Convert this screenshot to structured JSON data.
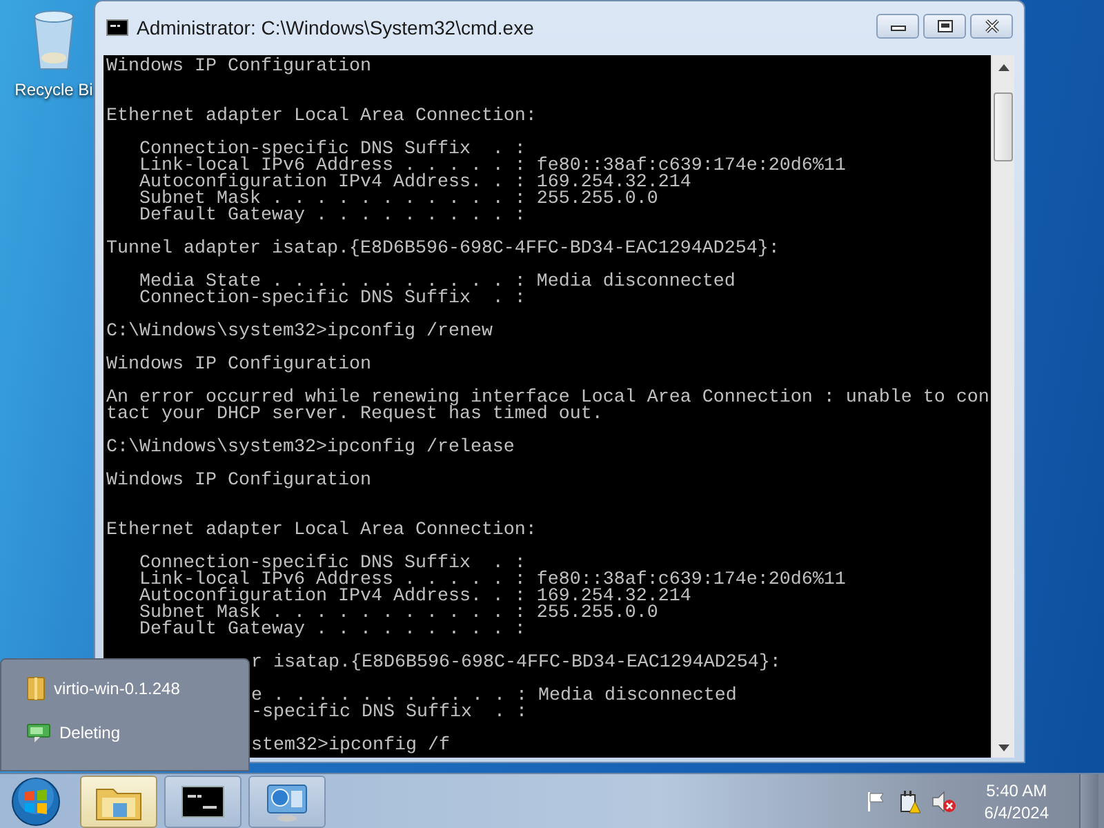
{
  "desktop": {
    "icons": [
      {
        "label": "Recycle Bi",
        "kind": "recycle-bin"
      }
    ]
  },
  "window": {
    "title": "Administrator: C:\\Windows\\System32\\cmd.exe",
    "console_lines": [
      {
        "kind": "line",
        "text": "Windows IP Configuration"
      },
      {
        "kind": "blank"
      },
      {
        "kind": "blank"
      },
      {
        "kind": "line",
        "text": "Ethernet adapter Local Area Connection:"
      },
      {
        "kind": "blank"
      },
      {
        "kind": "line",
        "text": "   Connection-specific DNS Suffix  . :"
      },
      {
        "kind": "line",
        "text": "   Link-local IPv6 Address . . . . . : fe80::38af:c639:174e:20d6%11"
      },
      {
        "kind": "line",
        "text": "   Autoconfiguration IPv4 Address. . : 169.254.32.214"
      },
      {
        "kind": "line",
        "text": "   Subnet Mask . . . . . . . . . . . : 255.255.0.0"
      },
      {
        "kind": "line",
        "text": "   Default Gateway . . . . . . . . . :"
      },
      {
        "kind": "blank"
      },
      {
        "kind": "line",
        "text": "Tunnel adapter isatap.{E8D6B596-698C-4FFC-BD34-EAC1294AD254}:"
      },
      {
        "kind": "blank"
      },
      {
        "kind": "line",
        "text": "   Media State . . . . . . . . . . . : Media disconnected"
      },
      {
        "kind": "line",
        "text": "   Connection-specific DNS Suffix  . :"
      },
      {
        "kind": "blank"
      },
      {
        "kind": "line",
        "text": "C:\\Windows\\system32>ipconfig /renew"
      },
      {
        "kind": "blank"
      },
      {
        "kind": "line",
        "text": "Windows IP Configuration"
      },
      {
        "kind": "blank"
      },
      {
        "kind": "line",
        "text": "An error occurred while renewing interface Local Area Connection : unable to con"
      },
      {
        "kind": "line",
        "text": "tact your DHCP server. Request has timed out."
      },
      {
        "kind": "blank"
      },
      {
        "kind": "line",
        "text": "C:\\Windows\\system32>ipconfig /release"
      },
      {
        "kind": "blank"
      },
      {
        "kind": "line",
        "text": "Windows IP Configuration"
      },
      {
        "kind": "blank"
      },
      {
        "kind": "blank"
      },
      {
        "kind": "line",
        "text": "Ethernet adapter Local Area Connection:"
      },
      {
        "kind": "blank"
      },
      {
        "kind": "line",
        "text": "   Connection-specific DNS Suffix  . :"
      },
      {
        "kind": "line",
        "text": "   Link-local IPv6 Address . . . . . : fe80::38af:c639:174e:20d6%11"
      },
      {
        "kind": "line",
        "text": "   Autoconfiguration IPv4 Address. . : 169.254.32.214"
      },
      {
        "kind": "line",
        "text": "   Subnet Mask . . . . . . . . . . . : 255.255.0.0"
      },
      {
        "kind": "line",
        "text": "   Default Gateway . . . . . . . . . :"
      },
      {
        "kind": "blank"
      },
      {
        "kind": "partial",
        "text": "r isatap.{E8D6B596-698C-4FFC-BD34-EAC1294AD254}:"
      },
      {
        "kind": "blank"
      },
      {
        "kind": "partial",
        "text": "e . . . . . . . . . . . : Media disconnected"
      },
      {
        "kind": "partial",
        "text": "-specific DNS Suffix  . :"
      },
      {
        "kind": "blank"
      },
      {
        "kind": "partial",
        "text": "stem32>ipconfig /f"
      }
    ]
  },
  "popup": {
    "items": [
      {
        "kind": "folder",
        "label": "virtio-win-0.1.248"
      },
      {
        "kind": "progress",
        "label": "Deleting"
      }
    ]
  },
  "taskbar": {
    "buttons": [
      {
        "kind": "explorer",
        "selected": true
      },
      {
        "kind": "cmd",
        "selected": false
      },
      {
        "kind": "network",
        "selected": false
      }
    ],
    "tray": {
      "time": "5:40 AM",
      "date": "6/4/2024"
    }
  }
}
